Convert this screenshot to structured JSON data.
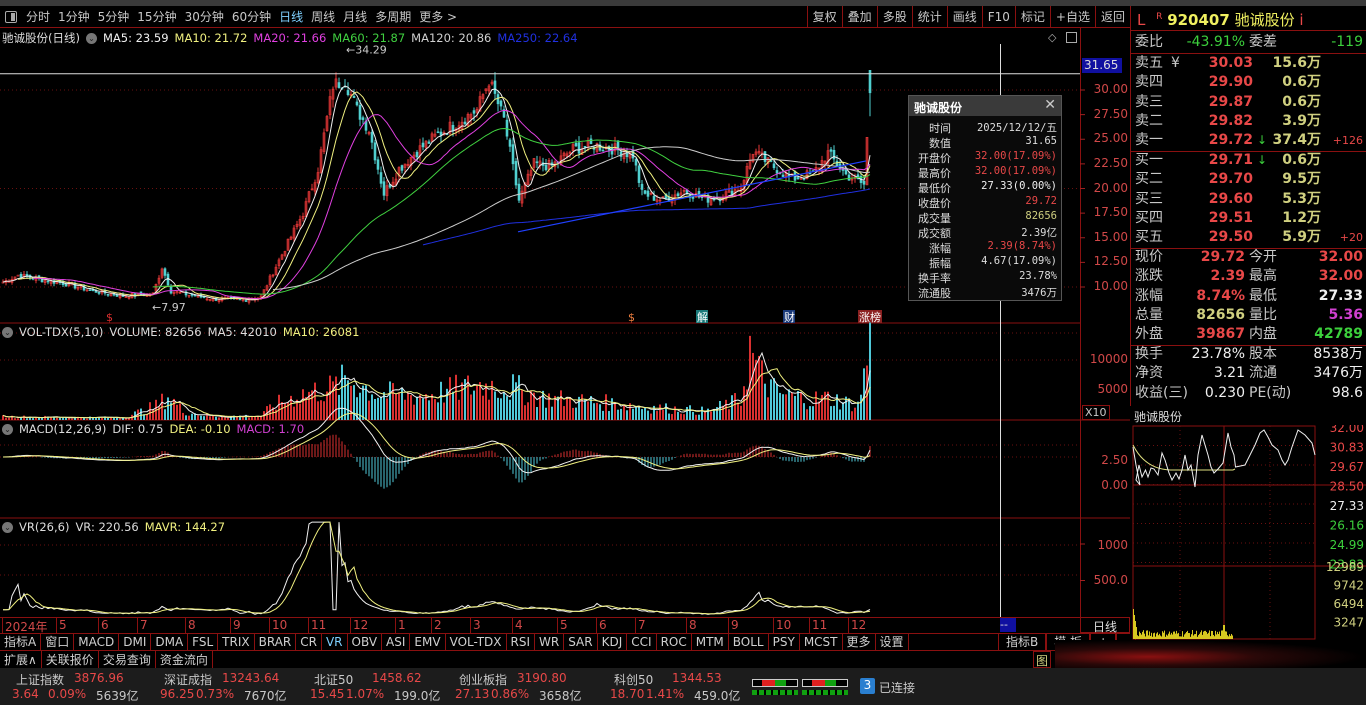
{
  "toolbar": {
    "periods": [
      "分时",
      "1分钟",
      "5分钟",
      "15分钟",
      "30分钟",
      "60分钟",
      "日线",
      "周线",
      "月线",
      "多周期",
      "更多 >"
    ],
    "active_period": "日线",
    "buttons": [
      "复权",
      "叠加",
      "多股",
      "统计",
      "画线",
      "F10",
      "标记",
      "+自选",
      "返回"
    ]
  },
  "main_legend": {
    "title": "驰诚股份(日线)",
    "ma": [
      {
        "label": "MA5: 23.59",
        "color": "#f0f0f0"
      },
      {
        "label": "MA10: 21.72",
        "color": "#f0f080"
      },
      {
        "label": "MA20: 21.66",
        "color": "#e040e0"
      },
      {
        "label": "MA60: 21.87",
        "color": "#40d040"
      },
      {
        "label": "MA120: 20.86",
        "color": "#d0d0d0"
      },
      {
        "label": "MA250: 22.64",
        "color": "#2030e0"
      }
    ],
    "high_label": "34.29",
    "low_label": "7.97",
    "crosshair_value": "31.65"
  },
  "price_axis": [
    "30.00",
    "27.50",
    "25.00",
    "22.50",
    "20.00",
    "17.50",
    "15.00",
    "12.50",
    "10.00"
  ],
  "price_axis_values": [
    30,
    27.5,
    25,
    22.5,
    20,
    17.5,
    15,
    12.5,
    10
  ],
  "event_markers": [
    {
      "label": "$",
      "bar": 35,
      "color": "#e03030",
      "bg": ""
    },
    {
      "label": "$",
      "bar": 209,
      "color": "#f08040",
      "bg": ""
    },
    {
      "label": "解",
      "bar": 232,
      "color": "#fff",
      "bg": "#1a7a7a"
    },
    {
      "label": "财",
      "bar": 261,
      "color": "#fff",
      "bg": "#1a3a7a"
    },
    {
      "label": "涨榜",
      "bar": 286,
      "color": "#fff",
      "bg": "#8a2020"
    }
  ],
  "price_keypoints": [
    [
      0,
      10.5
    ],
    [
      5,
      11.2
    ],
    [
      12,
      10.8
    ],
    [
      20,
      10.4
    ],
    [
      30,
      9.6
    ],
    [
      40,
      9.1
    ],
    [
      50,
      9.3
    ],
    [
      53,
      12.0
    ],
    [
      56,
      9.6
    ],
    [
      62,
      9.2
    ],
    [
      70,
      8.8
    ],
    [
      80,
      8.7
    ],
    [
      86,
      9.0
    ],
    [
      90,
      11.5
    ],
    [
      95,
      14.5
    ],
    [
      100,
      17.5
    ],
    [
      105,
      22
    ],
    [
      110,
      30.5
    ],
    [
      114,
      31
    ],
    [
      118,
      28
    ],
    [
      122,
      26
    ],
    [
      127,
      19.5
    ],
    [
      132,
      22
    ],
    [
      138,
      23.8
    ],
    [
      145,
      25.5
    ],
    [
      152,
      26.8
    ],
    [
      158,
      28
    ],
    [
      162,
      31
    ],
    [
      167,
      27
    ],
    [
      172,
      18.8
    ],
    [
      177,
      22.5
    ],
    [
      183,
      22.3
    ],
    [
      190,
      24
    ],
    [
      197,
      24.4
    ],
    [
      204,
      24.0
    ],
    [
      210,
      23.4
    ],
    [
      213,
      19.5
    ],
    [
      220,
      18.8
    ],
    [
      227,
      19.8
    ],
    [
      234,
      18.9
    ],
    [
      240,
      19.3
    ],
    [
      246,
      20.2
    ],
    [
      250,
      23.8
    ],
    [
      256,
      22.4
    ],
    [
      263,
      21.0
    ],
    [
      270,
      21.5
    ],
    [
      275,
      23.6
    ],
    [
      281,
      21.4
    ],
    [
      287,
      20.4
    ],
    [
      289,
      29.72
    ]
  ],
  "volume_keypoints": [
    [
      0,
      600
    ],
    [
      10,
      500
    ],
    [
      40,
      400
    ],
    [
      52,
      2600
    ],
    [
      55,
      4200
    ],
    [
      60,
      1500
    ],
    [
      70,
      600
    ],
    [
      86,
      700
    ],
    [
      90,
      2500
    ],
    [
      100,
      4500
    ],
    [
      110,
      5500
    ],
    [
      115,
      7000
    ],
    [
      125,
      4500
    ],
    [
      140,
      4200
    ],
    [
      160,
      6000
    ],
    [
      170,
      5500
    ],
    [
      180,
      3800
    ],
    [
      200,
      3000
    ],
    [
      215,
      2200
    ],
    [
      235,
      1500
    ],
    [
      246,
      3500
    ],
    [
      249,
      12000
    ],
    [
      252,
      8000
    ],
    [
      258,
      4500
    ],
    [
      270,
      3500
    ],
    [
      275,
      3800
    ],
    [
      285,
      2500
    ],
    [
      289,
      13000
    ]
  ],
  "vol_legend": {
    "name": "VOL-TDX(5,10)",
    "volume": "VOLUME: 82656",
    "ma5": "MA5: 42010",
    "ma10": "MA10: 26081",
    "axis": [
      "10000",
      "5000"
    ],
    "axis_values": [
      10000,
      5000
    ],
    "unit": "X10"
  },
  "macd_legend": {
    "name": "MACD(12,26,9)",
    "dif": "DIF: 0.75",
    "dea": "DEA: -0.10",
    "macd": "MACD: 1.70",
    "axis": [
      "2.50",
      "0.00"
    ]
  },
  "vr_legend": {
    "name": "VR(26,6)",
    "vr": "VR: 220.56",
    "mavr": "MAVR: 144.27",
    "axis": [
      "1000",
      "500.0"
    ]
  },
  "trendline": {
    "from": [
      172,
      15.6
    ],
    "to": [
      288,
      22.8
    ]
  },
  "date_axis": [
    [
      "2024年",
      0
    ],
    [
      "5",
      18
    ],
    [
      "6",
      32
    ],
    [
      "7",
      45
    ],
    [
      "8",
      61
    ],
    [
      "9",
      76
    ],
    [
      "10",
      89
    ],
    [
      "11",
      102
    ],
    [
      "12",
      116
    ],
    [
      "1",
      131
    ],
    [
      "2",
      143
    ],
    [
      "3",
      156
    ],
    [
      "4",
      170
    ],
    [
      "5",
      185
    ],
    [
      "6",
      198
    ],
    [
      "7",
      211
    ],
    [
      "8",
      228
    ],
    [
      "9",
      242
    ],
    [
      "10",
      257
    ],
    [
      "11",
      269
    ],
    [
      "12",
      282
    ]
  ],
  "date_cursor": "--",
  "tooltip": {
    "title": "驰诚股份",
    "rows": [
      {
        "k": "时间",
        "v": "2025/12/12/五",
        "c": "#ddd"
      },
      {
        "k": "数值",
        "v": "31.65",
        "c": "#ddd"
      },
      {
        "k": "开盘价",
        "v": "32.00(17.09%)",
        "c": "#e84848"
      },
      {
        "k": "最高价",
        "v": "32.00(17.09%)",
        "c": "#e84848"
      },
      {
        "k": "最低价",
        "v": "27.33(0.00%)",
        "c": "#f0f0f0"
      },
      {
        "k": "收盘价",
        "v": "29.72",
        "c": "#e84848"
      },
      {
        "k": "成交量",
        "v": "82656",
        "c": "#d0d080"
      },
      {
        "k": "成交额",
        "v": "2.39亿",
        "c": "#ddd"
      },
      {
        "k": "涨幅",
        "v": "2.39(8.74%)",
        "c": "#e84848"
      },
      {
        "k": "振幅",
        "v": "4.67(17.09%)",
        "c": "#ddd"
      },
      {
        "k": "换手率",
        "v": "23.78%",
        "c": "#ddd"
      },
      {
        "k": "流通股",
        "v": "3476万",
        "c": "#ddd"
      }
    ]
  },
  "quote": {
    "prefix": "L",
    "badge": "R",
    "code": "920407",
    "name": "驰诚股份",
    "info": "i",
    "weibi_label": "委比",
    "weibi": "-43.91%",
    "weicha_label": "委差",
    "weicha": "-119",
    "asks": [
      {
        "label": "卖五",
        "mark": "¥",
        "price": "30.03",
        "vol": "15.6万",
        "chg": ""
      },
      {
        "label": "卖四",
        "mark": "",
        "price": "29.90",
        "vol": "0.6万",
        "chg": ""
      },
      {
        "label": "卖三",
        "mark": "",
        "price": "29.87",
        "vol": "0.6万",
        "chg": ""
      },
      {
        "label": "卖二",
        "mark": "",
        "price": "29.82",
        "vol": "3.9万",
        "chg": ""
      },
      {
        "label": "卖一",
        "mark": "↓",
        "price": "29.72",
        "vol": "37.4万",
        "chg": "+126"
      }
    ],
    "bids": [
      {
        "label": "买一",
        "mark": "↓",
        "price": "29.71",
        "vol": "0.6万",
        "chg": ""
      },
      {
        "label": "买二",
        "mark": "",
        "price": "29.70",
        "vol": "9.5万",
        "chg": ""
      },
      {
        "label": "买三",
        "mark": "",
        "price": "29.60",
        "vol": "5.3万",
        "chg": ""
      },
      {
        "label": "买四",
        "mark": "",
        "price": "29.51",
        "vol": "1.2万",
        "chg": ""
      },
      {
        "label": "买五",
        "mark": "",
        "price": "29.50",
        "vol": "5.9万",
        "chg": "+20"
      }
    ],
    "stats": [
      {
        "l1": "现价",
        "v1": "29.72",
        "c1": "red",
        "l2": "今开",
        "v2": "32.00",
        "c2": "red"
      },
      {
        "l1": "涨跌",
        "v1": "2.39",
        "c1": "red",
        "l2": "最高",
        "v2": "32.00",
        "c2": "red"
      },
      {
        "l1": "涨幅",
        "v1": "8.74%",
        "c1": "red",
        "l2": "最低",
        "v2": "27.33",
        "c2": "wht"
      },
      {
        "l1": "总量",
        "v1": "82656",
        "c1": "yel",
        "l2": "量比",
        "v2": "5.36",
        "c2": "pur"
      },
      {
        "l1": "外盘",
        "v1": "39867",
        "c1": "red",
        "l2": "内盘",
        "v2": "42789",
        "c2": "grn"
      }
    ],
    "fund": [
      {
        "l1": "换手",
        "v1": "23.78%",
        "l2": "股本",
        "v2": "8538万"
      },
      {
        "l1": "净资",
        "v1": "3.21",
        "l2": "流通",
        "v2": "3476万"
      },
      {
        "l1": "收益(三)",
        "v1": "0.230",
        "l2": "PE(动)",
        "v2": "98.6"
      }
    ]
  },
  "intraday": {
    "title": "驰诚股份",
    "price_axis": [
      {
        "t": "32.00",
        "c": "#e84848"
      },
      {
        "t": "30.83",
        "c": "#e84848"
      },
      {
        "t": "29.67",
        "c": "#e84848"
      },
      {
        "t": "28.50",
        "c": "#e84848"
      },
      {
        "t": "27.33",
        "c": "#f0f0f0"
      },
      {
        "t": "26.16",
        "c": "#3cd03c"
      },
      {
        "t": "24.99",
        "c": "#3cd03c"
      },
      {
        "t": "23.83",
        "c": "#3cd03c"
      }
    ],
    "vol_axis": [
      "12989",
      "9742",
      "6494",
      "3247"
    ],
    "tab": "日线"
  },
  "indicator_tabs": [
    "指标A",
    "窗口",
    "MACD",
    "DMI",
    "DMA",
    "FSL",
    "TRIX",
    "BRAR",
    "CR",
    "VR",
    "OBV",
    "ASI",
    "EMV",
    "VOL-TDX",
    "RSI",
    "WR",
    "SAR",
    "KDJ",
    "CCI",
    "ROC",
    "MTM",
    "BOLL",
    "PSY",
    "MCST",
    "更多",
    "设置"
  ],
  "active_indicator": "VR",
  "right_tabs": [
    "指标B",
    "模 板",
    "+",
    "-"
  ],
  "ext_tabs": [
    "扩展∧",
    "关联报价",
    "交易查询",
    "资金流向"
  ],
  "ext_right": "图",
  "indices": [
    {
      "name": "上证指数",
      "value": "3876.96",
      "chg": "3.64",
      "pct": "0.09%",
      "amt": "5639亿"
    },
    {
      "name": "深证成指",
      "value": "13243.64",
      "chg": "96.25",
      "pct": "0.73%",
      "amt": "7670亿"
    },
    {
      "name": "北证50",
      "value": "1458.62",
      "chg": "15.45",
      "pct": "1.07%",
      "amt": "199.0亿"
    },
    {
      "name": "创业板指",
      "value": "3190.80",
      "chg": "27.13",
      "pct": "0.86%",
      "amt": "3658亿"
    },
    {
      "name": "科创50",
      "value": "1344.53",
      "chg": "18.70",
      "pct": "1.41%",
      "amt": "459.0亿"
    }
  ],
  "connection": {
    "count": "3",
    "label": "已连接"
  },
  "colors": {
    "up": "#e84848",
    "down": "#3cd03c",
    "frame": "#8a1010",
    "vol": "#d0d080"
  }
}
